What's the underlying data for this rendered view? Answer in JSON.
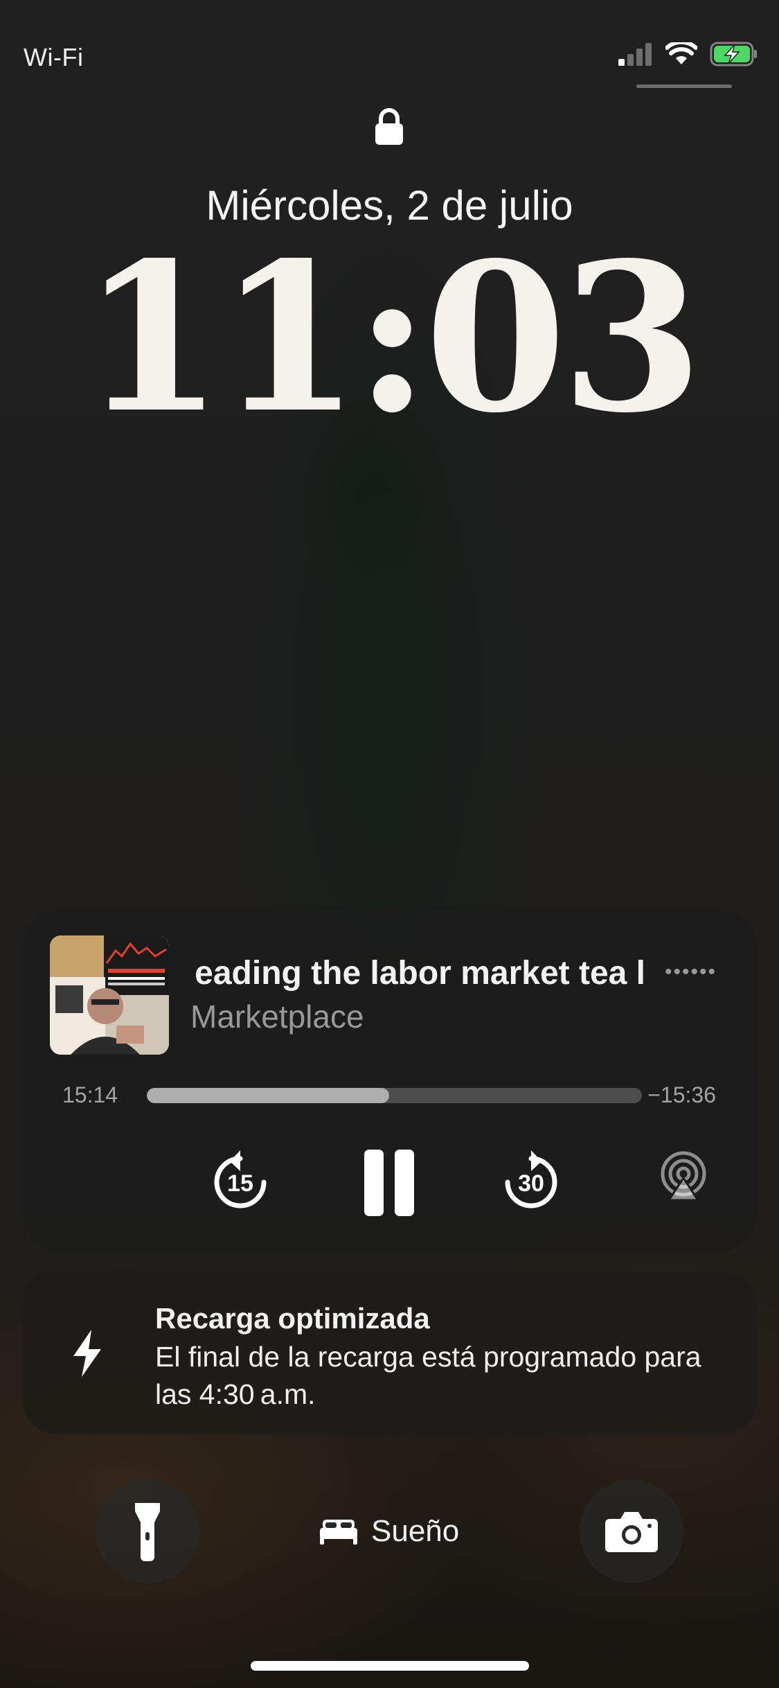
{
  "status_bar": {
    "network": "Wi-Fi",
    "signal_icon": "cellular-signal-icon",
    "wifi_icon": "wifi-icon",
    "battery_icon": "battery-charging-icon",
    "battery_color": "#4cd964"
  },
  "lockscreen": {
    "lock_icon": "lock-icon",
    "date": "Miércoles, 2 de julio",
    "time": "11:03"
  },
  "now_playing": {
    "artwork_icon": "podcast-artwork",
    "title": "eading the labor market tea l",
    "more_icon": "more-dots-icon",
    "show": "Marketplace",
    "elapsed": "15:14",
    "remaining": "−15:36",
    "progress_fraction": 0.49,
    "skip_back_seconds": "15",
    "skip_forward_seconds": "30",
    "pause_icon": "pause-icon",
    "airplay_icon": "airplay-icon"
  },
  "notification": {
    "icon": "bolt-icon",
    "title": "Recarga optimizada",
    "body": "El final de la recarga está programado para las 4:30 a.m."
  },
  "quick_actions": {
    "flashlight_icon": "flashlight-icon",
    "focus_icon": "bed-icon",
    "focus_label": "Sueño",
    "camera_icon": "camera-icon"
  }
}
